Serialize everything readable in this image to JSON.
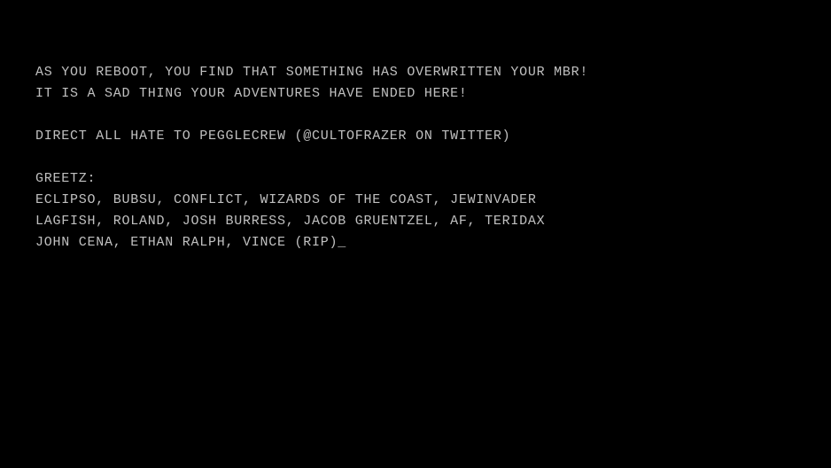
{
  "terminal": {
    "lines": [
      "AS YOU REBOOT, YOU FIND THAT SOMETHING HAS OVERWRITTEN YOUR MBR!",
      "IT IS A SAD THING YOUR ADVENTURES HAVE ENDED HERE!",
      "",
      "DIRECT ALL HATE TO PEGGLECREW (@CULTOFRAZER ON TWITTER)",
      "",
      "GREETZ:",
      "ECLIPSO, BUBSU, CONFLICT, WIZARDS OF THE COAST, JEWINVADER",
      "LAGFISH, ROLAND, JOSH BURRESS, JACOB GRUENTZEL, AF, TERIDAX",
      "JOHN CENA, ETHAN RALPH, VINCE (RIP)_"
    ]
  }
}
